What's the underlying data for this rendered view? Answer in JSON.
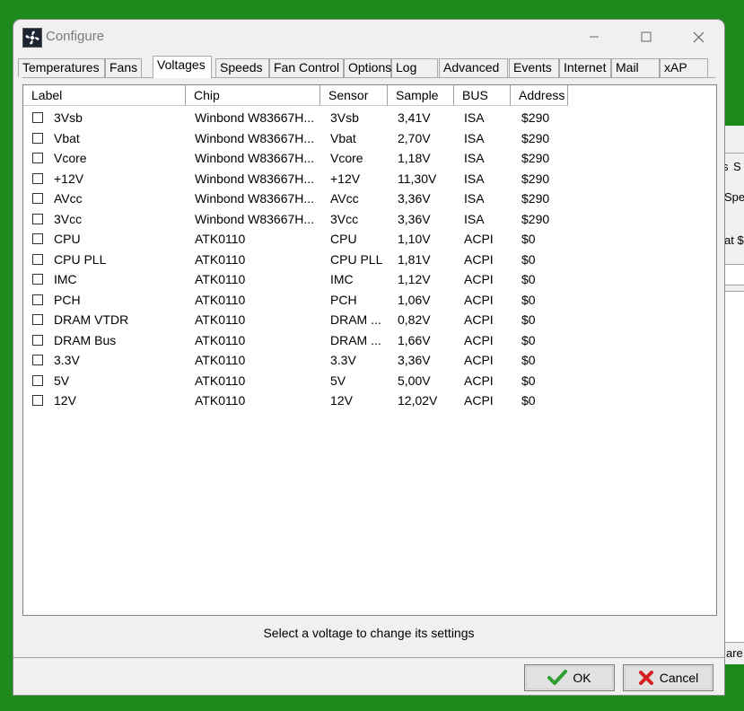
{
  "window": {
    "title": "Configure"
  },
  "tabs": [
    {
      "label": "Temperatures",
      "active": false
    },
    {
      "label": "Fans",
      "active": false
    },
    {
      "label": "Voltages",
      "active": true
    },
    {
      "label": "Speeds",
      "active": false
    },
    {
      "label": "Fan Control",
      "active": false
    },
    {
      "label": "Options",
      "active": false
    },
    {
      "label": "Log",
      "active": false
    },
    {
      "label": "Advanced",
      "active": false
    },
    {
      "label": "Events",
      "active": false
    },
    {
      "label": "Internet",
      "active": false
    },
    {
      "label": "Mail",
      "active": false
    },
    {
      "label": "xAP",
      "active": false
    }
  ],
  "columns": [
    "Label",
    "Chip",
    "Sensor",
    "Sample",
    "BUS",
    "Address"
  ],
  "rows": [
    {
      "label": "3Vsb",
      "chip": "Winbond W83667H...",
      "sensor": "3Vsb",
      "sample": "3,41V",
      "bus": "ISA",
      "address": "$290"
    },
    {
      "label": "Vbat",
      "chip": "Winbond W83667H...",
      "sensor": "Vbat",
      "sample": "2,70V",
      "bus": "ISA",
      "address": "$290"
    },
    {
      "label": "Vcore",
      "chip": "Winbond W83667H...",
      "sensor": "Vcore",
      "sample": "1,18V",
      "bus": "ISA",
      "address": "$290"
    },
    {
      "label": "+12V",
      "chip": "Winbond W83667H...",
      "sensor": "+12V",
      "sample": "11,30V",
      "bus": "ISA",
      "address": "$290"
    },
    {
      "label": "AVcc",
      "chip": "Winbond W83667H...",
      "sensor": "AVcc",
      "sample": "3,36V",
      "bus": "ISA",
      "address": "$290"
    },
    {
      "label": "3Vcc",
      "chip": "Winbond W83667H...",
      "sensor": "3Vcc",
      "sample": "3,36V",
      "bus": "ISA",
      "address": "$290"
    },
    {
      "label": "CPU",
      "chip": "ATK0110",
      "sensor": "CPU",
      "sample": "1,10V",
      "bus": "ACPI",
      "address": "$0"
    },
    {
      "label": "CPU PLL",
      "chip": "ATK0110",
      "sensor": "CPU PLL",
      "sample": "1,81V",
      "bus": "ACPI",
      "address": "$0"
    },
    {
      "label": "IMC",
      "chip": "ATK0110",
      "sensor": "IMC",
      "sample": "1,12V",
      "bus": "ACPI",
      "address": "$0"
    },
    {
      "label": "PCH",
      "chip": "ATK0110",
      "sensor": "PCH",
      "sample": "1,06V",
      "bus": "ACPI",
      "address": "$0"
    },
    {
      "label": "DRAM VTDR",
      "chip": "ATK0110",
      "sensor": "DRAM ...",
      "sample": "0,82V",
      "bus": "ACPI",
      "address": "$0"
    },
    {
      "label": "DRAM Bus",
      "chip": "ATK0110",
      "sensor": "DRAM ...",
      "sample": "1,66V",
      "bus": "ACPI",
      "address": "$0"
    },
    {
      "label": "3.3V",
      "chip": "ATK0110",
      "sensor": "3.3V",
      "sample": "3,36V",
      "bus": "ACPI",
      "address": "$0"
    },
    {
      "label": "5V",
      "chip": "ATK0110",
      "sensor": "5V",
      "sample": "5,00V",
      "bus": "ACPI",
      "address": "$0"
    },
    {
      "label": "12V",
      "chip": "ATK0110",
      "sensor": "12V",
      "sample": "12,02V",
      "bus": "ACPI",
      "address": "$0"
    }
  ],
  "status_text": "Select a voltage to change its settings",
  "buttons": {
    "ok": "OK",
    "cancel": "Cancel"
  },
  "icons": {
    "ok": "checkmark-icon",
    "cancel": "red-x-icon"
  },
  "colors": {
    "desktop": "#1e8a1e",
    "ok_check": "#2e9e2e",
    "cancel_x": "#d42020"
  },
  "background_window": {
    "fragments": [
      "s",
      "S",
      "Spe",
      "at $",
      "are"
    ]
  }
}
